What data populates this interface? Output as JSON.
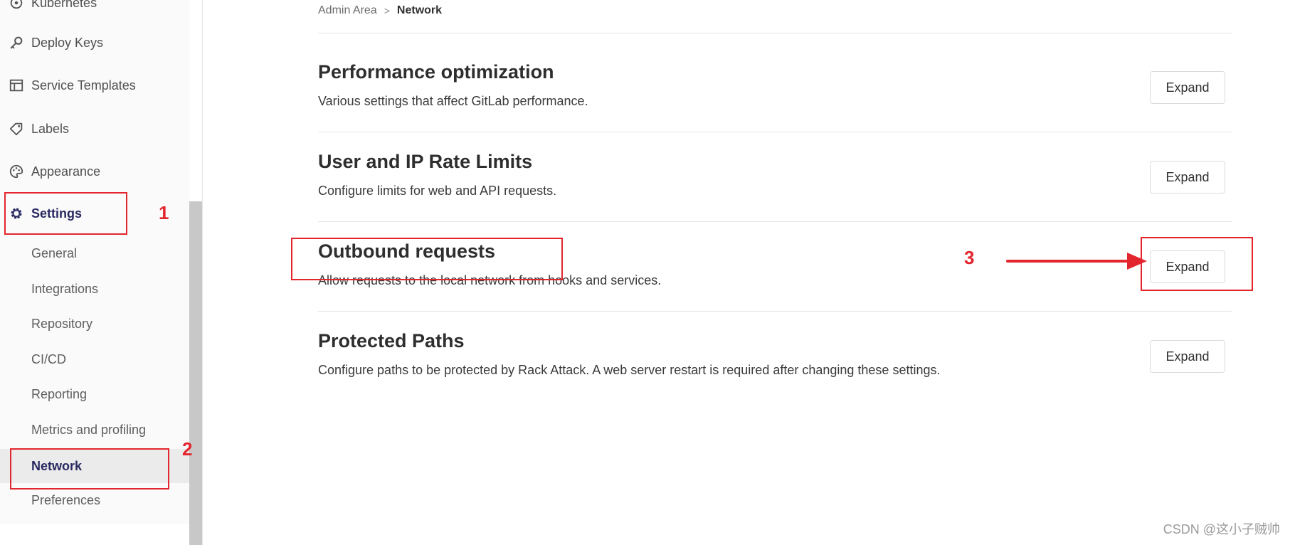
{
  "sidebar": {
    "items": [
      {
        "label": "Kubernetes",
        "icon": "kubernetes-icon"
      },
      {
        "label": "Deploy Keys",
        "icon": "key-icon"
      },
      {
        "label": "Service Templates",
        "icon": "template-icon"
      },
      {
        "label": "Labels",
        "icon": "label-icon"
      },
      {
        "label": "Appearance",
        "icon": "palette-icon"
      },
      {
        "label": "Settings",
        "icon": "gear-icon",
        "active": true
      }
    ],
    "settings_subitems": [
      {
        "label": "General"
      },
      {
        "label": "Integrations"
      },
      {
        "label": "Repository"
      },
      {
        "label": "CI/CD"
      },
      {
        "label": "Reporting"
      },
      {
        "label": "Metrics and profiling"
      },
      {
        "label": "Network",
        "active": true
      },
      {
        "label": "Preferences"
      }
    ]
  },
  "breadcrumb": {
    "parent": "Admin Area",
    "separator": ">",
    "current": "Network"
  },
  "sections": [
    {
      "title": "Performance optimization",
      "description": "Various settings that affect GitLab performance.",
      "button": "Expand"
    },
    {
      "title": "User and IP Rate Limits",
      "description": "Configure limits for web and API requests.",
      "button": "Expand"
    },
    {
      "title": "Outbound requests",
      "description": "Allow requests to the local network from hooks and services.",
      "button": "Expand"
    },
    {
      "title": "Protected Paths",
      "description": "Configure paths to be protected by Rack Attack. A web server restart is required after changing these settings.",
      "button": "Expand"
    }
  ],
  "annotations": {
    "step1": "1",
    "step2": "2",
    "step3": "3",
    "color": "#e3262d"
  },
  "watermark": "CSDN @这小子贼帅",
  "colors": {
    "active_nav": "#292961",
    "sidebar_bg": "#fafafa",
    "border": "#e5e5e5"
  }
}
